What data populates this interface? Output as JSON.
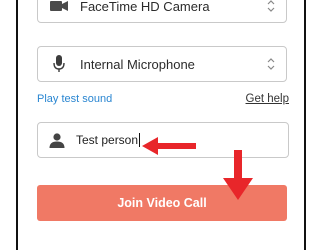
{
  "camera": {
    "label": "FaceTime HD Camera",
    "icon": "video-camera-icon"
  },
  "microphone": {
    "label": "Internal Microphone",
    "icon": "microphone-icon"
  },
  "links": {
    "test_sound": "Play test sound",
    "help": "Get help"
  },
  "name_field": {
    "value": "Test person",
    "icon": "person-icon"
  },
  "join_button": {
    "label": "Join Video Call"
  },
  "colors": {
    "accent": "#f07965",
    "link": "#2a86d1",
    "annotation_arrow": "#e8262a"
  }
}
